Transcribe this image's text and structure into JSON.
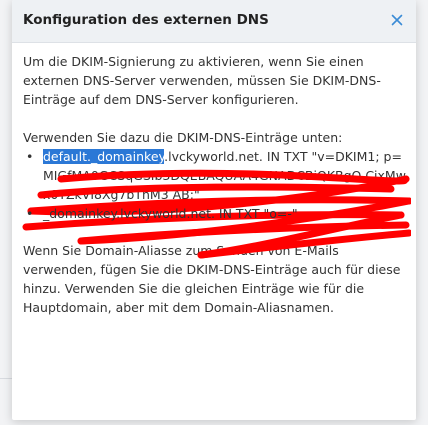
{
  "dialog": {
    "title": "Konfiguration des externen DNS",
    "close_icon": "close-icon",
    "intro": "Um die DKIM-Signierung zu aktivieren, wenn Sie einen externen DNS-Server verwenden, müssen Sie DKIM-DNS-Einträge auf dem DNS-Server konfigurieren.",
    "list_intro": "Verwenden Sie dazu die DKIM-DNS-Einträge unten:",
    "entries": [
      {
        "selected": "default._domainkey",
        "text": ".lvckyworld.net. IN TXT \"v=DKIM1; p=MIGfMA0GCSqGSIb3DQEBAQUAA4GNADCBiQKBgQ CjxMwx0YZkVI8Xg7bTnM3 AB;\""
      },
      {
        "text": "_domainkey.lvckyworld.net. IN TXT \"o=-\""
      }
    ],
    "alias_note": "Wenn Sie Domain-Aliasse zum Senden von E-Mails verwenden, fügen Sie die DKIM-DNS-Einträge auch für diese hinzu. Verwenden Sie die gleichen Einträge wie für die Hauptdomain, aber mit dem Domain-Aliasnamen."
  },
  "colors": {
    "accent": "#3a8bd6",
    "selection": "#2b78d6",
    "redaction": "#ff0000"
  }
}
